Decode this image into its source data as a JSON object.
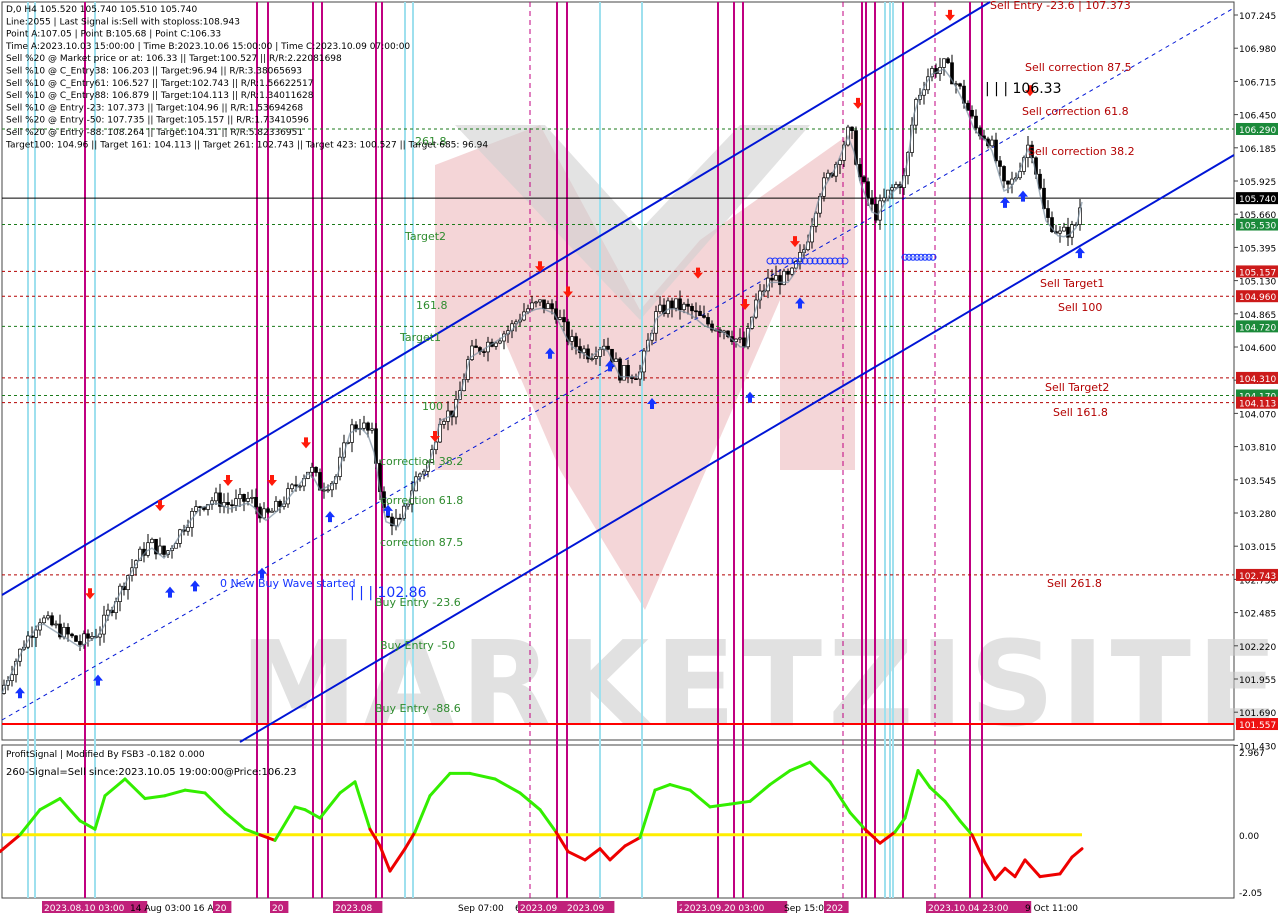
{
  "colors": {
    "background": "#ffffff",
    "watermark": "#e7a4a8",
    "channel": "#0015d6",
    "buy_arrow": "#1533ff",
    "sell_arrow": "#ff1a0a",
    "magenta_line": "#c00080",
    "cyan_line": "#9ee0ee",
    "red_level": "#b30000",
    "green_level": "#1b7a1b",
    "bid_line": "#ff0000",
    "osc_green": "#33ee00",
    "osc_red": "#ee0000",
    "osc_zero": "#ffee00"
  },
  "info_panel": [
    "D,0 H4  105.520 105.740 105.510 105.740",
    "Line:2055  | Last Signal is:Sell with stoploss:108.943",
    "Point A:107.05 | Point B:105.68 | Point C:106.33",
    "Time A:2023.10.03 15:00:00 | Time B:2023.10.06 15:00:00 | Time C:2023.10.09 07:00:00",
    "Sell %20 @ Market price or at: 106.33 || Target:100.527 || R/R:2.22081698",
    "Sell %10 @ C_Entry38: 106.203 || Target:96.94 || R/R:3.38065693",
    "Sell %10 @ C_Entry61: 106.527 || Target:102.743 || R/R:1.56622517",
    "Sell %10 @ C_Entry88: 106.879 || Target:104.113 || R/R:1.34011628",
    "Sell %10 @ Entry -23: 107.373 || Target:104.96 || R/R:1.53694268",
    "Sell %20 @ Entry -50: 107.735 || Target:105.157 || R/R:1.73410596",
    "Sell %20 @ Entry -88: 108.264 || Target:104.31 || R/R:5.82336951",
    "Target100: 104.96 || Target 161: 104.113 || Target 261: 102.743 || Target 423: 100.527 || Target 685: 96.94"
  ],
  "price_axis": {
    "ticks": [
      "107.245",
      "106.980",
      "106.715",
      "106.450",
      "106.185",
      "105.925",
      "105.660",
      "105.395",
      "105.130",
      "104.865",
      "104.600",
      "104.335",
      "104.070",
      "103.810",
      "103.545",
      "103.280",
      "103.015",
      "102.750",
      "102.485",
      "102.220",
      "101.955",
      "101.690",
      "101.430"
    ],
    "current_price": "105.740"
  },
  "level_labels": {
    "sell_entry": "Sell Entry -23.6 | 107.373",
    "sell_correction_875": "Sell correction 87.5",
    "point_c": "| | | 106.33",
    "sell_correction_618": "Sell correction 61.8",
    "sell_correction_382": "Sell correction 38.2",
    "sell_target1": "Sell Target1",
    "sell_100": "Sell 100",
    "sell_target2": "Sell Target2",
    "sell_1618": "Sell 161.8",
    "sell_2618": "Sell  261.8",
    "target2": "Target2",
    "l1618": "161.8",
    "target1": "Target1",
    "l100": "100",
    "corr_382": "correction 38.2",
    "corr_618": "correction 61.8",
    "corr_875": "correction 87.5",
    "new_buy_wave": "0 New Buy Wave started",
    "buy_point": "| | | 102.86",
    "buy_entry_236": "Buy Entry -23.6",
    "buy_entry_50": "Buy Entry -50",
    "buy_entry_886": "Buy Entry -88.6",
    "l2618": "261.8"
  },
  "price_tags": [
    {
      "text": "106.290",
      "bg": "#1b8a3a"
    },
    {
      "text": "105.740",
      "bg": "#000000"
    },
    {
      "text": "105.530",
      "bg": "#1b8a3a"
    },
    {
      "text": "105.157",
      "bg": "#cc1a1a"
    },
    {
      "text": "104.960",
      "bg": "#cc1a1a"
    },
    {
      "text": "104.720",
      "bg": "#1b8a3a"
    },
    {
      "text": "104.310",
      "bg": "#cc1a1a"
    },
    {
      "text": "104.170",
      "bg": "#1b8a3a"
    },
    {
      "text": "104.113",
      "bg": "#cc1a1a"
    },
    {
      "text": "102.743",
      "bg": "#cc1a1a"
    },
    {
      "text": "101.557",
      "bg": "#ee1111"
    }
  ],
  "watermark_text": "MARKETZISITE",
  "oscillator": {
    "title": "ProfitSignal | Modified By FSB3 -0.182 0.000",
    "signal_text": "260-Signal=Sell since:2023.10.05 19:00:00@Price:106.23",
    "axis_ticks": [
      "2.967",
      "0.00",
      "-2.05"
    ]
  },
  "time_axis": {
    "labels": [
      {
        "text": "2023.08.10 03:00",
        "hl": true
      },
      {
        "text": "14 Aug 03:00",
        "hl": false
      },
      {
        "text": "16 A",
        "hl": false
      },
      {
        "text": "20",
        "hl": true
      },
      {
        "text": "20",
        "hl": true
      },
      {
        "text": "2023.08",
        "hl": true
      },
      {
        "text": "Sep 07:00",
        "hl": false
      },
      {
        "text": "6",
        "hl": false
      },
      {
        "text": "2023.09",
        "hl": true
      },
      {
        "text": "2023.09",
        "hl": true
      },
      {
        "text": "20",
        "hl": true
      },
      {
        "text": "2023.09.20 03:00",
        "hl": true
      },
      {
        "text": "Sep 15:00",
        "hl": false
      },
      {
        "text": "202",
        "hl": true
      },
      {
        "text": "2023.10.04 23:00",
        "hl": true
      },
      {
        "text": "9 Oct 11:00",
        "hl": false
      }
    ]
  },
  "chart_data": {
    "type": "candlestick",
    "symbol_timeframe": "H4",
    "price_range": [
      101.43,
      107.3
    ],
    "close_path": [
      [
        0,
        101.8
      ],
      [
        12,
        102.0
      ],
      [
        24,
        102.2
      ],
      [
        40,
        102.4
      ],
      [
        60,
        102.3
      ],
      [
        80,
        102.2
      ],
      [
        100,
        102.3
      ],
      [
        115,
        102.55
      ],
      [
        135,
        102.85
      ],
      [
        150,
        103.0
      ],
      [
        165,
        102.9
      ],
      [
        185,
        103.15
      ],
      [
        200,
        103.3
      ],
      [
        215,
        103.35
      ],
      [
        230,
        103.3
      ],
      [
        250,
        103.35
      ],
      [
        265,
        103.2
      ],
      [
        280,
        103.3
      ],
      [
        295,
        103.45
      ],
      [
        310,
        103.6
      ],
      [
        320,
        103.45
      ],
      [
        335,
        103.5
      ],
      [
        350,
        103.9
      ],
      [
        360,
        103.95
      ],
      [
        372,
        103.85
      ],
      [
        385,
        103.2
      ],
      [
        400,
        103.15
      ],
      [
        415,
        103.5
      ],
      [
        430,
        103.65
      ],
      [
        440,
        104.0
      ],
      [
        455,
        104.05
      ],
      [
        470,
        104.5
      ],
      [
        490,
        104.6
      ],
      [
        510,
        104.7
      ],
      [
        525,
        104.85
      ],
      [
        540,
        104.9
      ],
      [
        555,
        104.85
      ],
      [
        570,
        104.6
      ],
      [
        590,
        104.5
      ],
      [
        605,
        104.6
      ],
      [
        620,
        104.35
      ],
      [
        640,
        104.35
      ],
      [
        655,
        104.8
      ],
      [
        670,
        104.9
      ],
      [
        690,
        104.85
      ],
      [
        705,
        104.75
      ],
      [
        725,
        104.7
      ],
      [
        745,
        104.55
      ],
      [
        755,
        104.9
      ],
      [
        770,
        105.1
      ],
      [
        790,
        105.1
      ],
      [
        805,
        105.35
      ],
      [
        820,
        105.8
      ],
      [
        835,
        106.0
      ],
      [
        850,
        106.3
      ],
      [
        860,
        105.9
      ],
      [
        875,
        105.6
      ],
      [
        890,
        105.8
      ],
      [
        905,
        105.9
      ],
      [
        915,
        106.5
      ],
      [
        930,
        106.75
      ],
      [
        945,
        106.8
      ],
      [
        960,
        106.6
      ],
      [
        975,
        106.3
      ],
      [
        990,
        106.2
      ],
      [
        1005,
        105.8
      ],
      [
        1015,
        105.9
      ],
      [
        1030,
        106.2
      ],
      [
        1045,
        105.6
      ],
      [
        1060,
        105.45
      ],
      [
        1075,
        105.5
      ],
      [
        1082,
        105.74
      ]
    ],
    "levels": [
      {
        "name": "Sell Entry -23.6",
        "price": 107.373,
        "side": "sell"
      },
      {
        "name": "Sell correction 87.5",
        "price": 106.879,
        "side": "sell"
      },
      {
        "name": "Point C",
        "price": 106.33,
        "side": "sell"
      },
      {
        "name": "Sell correction 61.8",
        "price": 106.527,
        "side": "sell"
      },
      {
        "name": "Sell correction 38.2",
        "price": 106.203,
        "side": "sell"
      },
      {
        "name": "Sell Target1",
        "price": 105.157,
        "side": "sell"
      },
      {
        "name": "Sell 100",
        "price": 104.96,
        "side": "sell"
      },
      {
        "name": "Sell Target2",
        "price": 104.31,
        "side": "sell"
      },
      {
        "name": "Sell 161.8",
        "price": 104.113,
        "side": "sell"
      },
      {
        "name": "Sell 261.8",
        "price": 102.743,
        "side": "sell"
      },
      {
        "name": "Target2",
        "price": 105.53,
        "side": "buy"
      },
      {
        "name": "161.8",
        "price": 104.96,
        "side": "buy"
      },
      {
        "name": "Target1",
        "price": 104.72,
        "side": "buy"
      },
      {
        "name": "100",
        "price": 104.17,
        "side": "buy"
      },
      {
        "name": "261.8",
        "price": 106.29,
        "side": "buy"
      },
      {
        "name": "Current",
        "price": 105.74,
        "side": "bid"
      },
      {
        "name": "Bid line",
        "price": 101.557,
        "side": "bid"
      }
    ],
    "oscillator_series": [
      [
        0,
        -0.6
      ],
      [
        20,
        0.0
      ],
      [
        40,
        0.9
      ],
      [
        60,
        1.3
      ],
      [
        80,
        0.5
      ],
      [
        95,
        0.2
      ],
      [
        105,
        1.4
      ],
      [
        125,
        2.0
      ],
      [
        145,
        1.3
      ],
      [
        165,
        1.4
      ],
      [
        185,
        1.6
      ],
      [
        205,
        1.5
      ],
      [
        225,
        0.8
      ],
      [
        245,
        0.2
      ],
      [
        260,
        0.0
      ],
      [
        275,
        -0.2
      ],
      [
        295,
        1.0
      ],
      [
        305,
        0.9
      ],
      [
        320,
        0.6
      ],
      [
        340,
        1.5
      ],
      [
        355,
        1.9
      ],
      [
        370,
        0.2
      ],
      [
        380,
        -0.4
      ],
      [
        390,
        -1.3
      ],
      [
        405,
        -0.5
      ],
      [
        415,
        0.1
      ],
      [
        430,
        1.4
      ],
      [
        450,
        2.2
      ],
      [
        470,
        2.2
      ],
      [
        495,
        2.0
      ],
      [
        520,
        1.5
      ],
      [
        540,
        0.9
      ],
      [
        556,
        0.1
      ],
      [
        568,
        -0.6
      ],
      [
        585,
        -0.9
      ],
      [
        600,
        -0.5
      ],
      [
        610,
        -0.9
      ],
      [
        625,
        -0.4
      ],
      [
        640,
        -0.1
      ],
      [
        655,
        1.6
      ],
      [
        670,
        1.8
      ],
      [
        690,
        1.6
      ],
      [
        710,
        1.0
      ],
      [
        730,
        1.1
      ],
      [
        750,
        1.2
      ],
      [
        770,
        1.8
      ],
      [
        790,
        2.3
      ],
      [
        810,
        2.6
      ],
      [
        830,
        1.9
      ],
      [
        850,
        0.8
      ],
      [
        865,
        0.2
      ],
      [
        880,
        -0.3
      ],
      [
        895,
        0.1
      ],
      [
        905,
        0.6
      ],
      [
        918,
        2.3
      ],
      [
        930,
        1.7
      ],
      [
        945,
        1.2
      ],
      [
        960,
        0.5
      ],
      [
        972,
        0.0
      ],
      [
        985,
        -1.0
      ],
      [
        995,
        -1.6
      ],
      [
        1005,
        -1.2
      ],
      [
        1015,
        -1.5
      ],
      [
        1025,
        -0.9
      ],
      [
        1040,
        -1.5
      ],
      [
        1060,
        -1.4
      ],
      [
        1072,
        -0.8
      ],
      [
        1082,
        -0.5
      ]
    ],
    "oscillator_range": [
      -2.05,
      2.967
    ]
  }
}
